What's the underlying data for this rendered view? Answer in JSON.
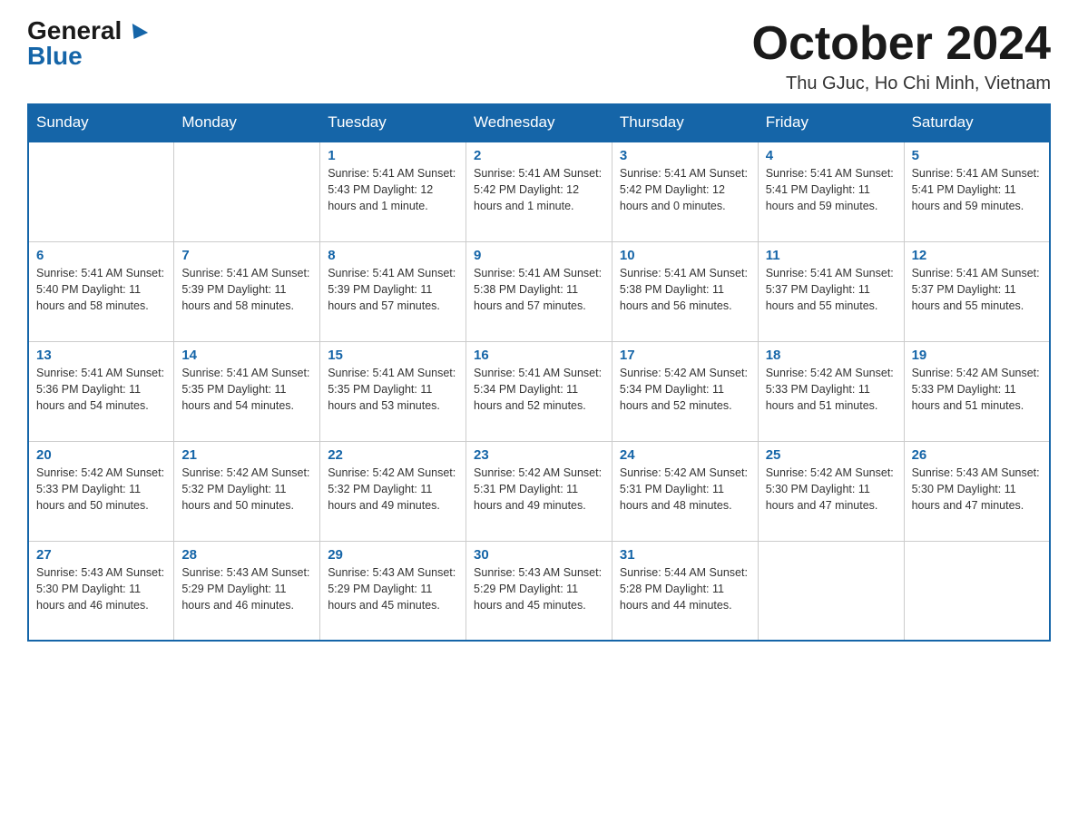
{
  "header": {
    "logo_general": "General",
    "logo_blue": "Blue",
    "month_title": "October 2024",
    "location": "Thu GJuc, Ho Chi Minh, Vietnam"
  },
  "days_of_week": [
    "Sunday",
    "Monday",
    "Tuesday",
    "Wednesday",
    "Thursday",
    "Friday",
    "Saturday"
  ],
  "weeks": [
    [
      {
        "day": "",
        "info": ""
      },
      {
        "day": "",
        "info": ""
      },
      {
        "day": "1",
        "info": "Sunrise: 5:41 AM\nSunset: 5:43 PM\nDaylight: 12 hours\nand 1 minute."
      },
      {
        "day": "2",
        "info": "Sunrise: 5:41 AM\nSunset: 5:42 PM\nDaylight: 12 hours\nand 1 minute."
      },
      {
        "day": "3",
        "info": "Sunrise: 5:41 AM\nSunset: 5:42 PM\nDaylight: 12 hours\nand 0 minutes."
      },
      {
        "day": "4",
        "info": "Sunrise: 5:41 AM\nSunset: 5:41 PM\nDaylight: 11 hours\nand 59 minutes."
      },
      {
        "day": "5",
        "info": "Sunrise: 5:41 AM\nSunset: 5:41 PM\nDaylight: 11 hours\nand 59 minutes."
      }
    ],
    [
      {
        "day": "6",
        "info": "Sunrise: 5:41 AM\nSunset: 5:40 PM\nDaylight: 11 hours\nand 58 minutes."
      },
      {
        "day": "7",
        "info": "Sunrise: 5:41 AM\nSunset: 5:39 PM\nDaylight: 11 hours\nand 58 minutes."
      },
      {
        "day": "8",
        "info": "Sunrise: 5:41 AM\nSunset: 5:39 PM\nDaylight: 11 hours\nand 57 minutes."
      },
      {
        "day": "9",
        "info": "Sunrise: 5:41 AM\nSunset: 5:38 PM\nDaylight: 11 hours\nand 57 minutes."
      },
      {
        "day": "10",
        "info": "Sunrise: 5:41 AM\nSunset: 5:38 PM\nDaylight: 11 hours\nand 56 minutes."
      },
      {
        "day": "11",
        "info": "Sunrise: 5:41 AM\nSunset: 5:37 PM\nDaylight: 11 hours\nand 55 minutes."
      },
      {
        "day": "12",
        "info": "Sunrise: 5:41 AM\nSunset: 5:37 PM\nDaylight: 11 hours\nand 55 minutes."
      }
    ],
    [
      {
        "day": "13",
        "info": "Sunrise: 5:41 AM\nSunset: 5:36 PM\nDaylight: 11 hours\nand 54 minutes."
      },
      {
        "day": "14",
        "info": "Sunrise: 5:41 AM\nSunset: 5:35 PM\nDaylight: 11 hours\nand 54 minutes."
      },
      {
        "day": "15",
        "info": "Sunrise: 5:41 AM\nSunset: 5:35 PM\nDaylight: 11 hours\nand 53 minutes."
      },
      {
        "day": "16",
        "info": "Sunrise: 5:41 AM\nSunset: 5:34 PM\nDaylight: 11 hours\nand 52 minutes."
      },
      {
        "day": "17",
        "info": "Sunrise: 5:42 AM\nSunset: 5:34 PM\nDaylight: 11 hours\nand 52 minutes."
      },
      {
        "day": "18",
        "info": "Sunrise: 5:42 AM\nSunset: 5:33 PM\nDaylight: 11 hours\nand 51 minutes."
      },
      {
        "day": "19",
        "info": "Sunrise: 5:42 AM\nSunset: 5:33 PM\nDaylight: 11 hours\nand 51 minutes."
      }
    ],
    [
      {
        "day": "20",
        "info": "Sunrise: 5:42 AM\nSunset: 5:33 PM\nDaylight: 11 hours\nand 50 minutes."
      },
      {
        "day": "21",
        "info": "Sunrise: 5:42 AM\nSunset: 5:32 PM\nDaylight: 11 hours\nand 50 minutes."
      },
      {
        "day": "22",
        "info": "Sunrise: 5:42 AM\nSunset: 5:32 PM\nDaylight: 11 hours\nand 49 minutes."
      },
      {
        "day": "23",
        "info": "Sunrise: 5:42 AM\nSunset: 5:31 PM\nDaylight: 11 hours\nand 49 minutes."
      },
      {
        "day": "24",
        "info": "Sunrise: 5:42 AM\nSunset: 5:31 PM\nDaylight: 11 hours\nand 48 minutes."
      },
      {
        "day": "25",
        "info": "Sunrise: 5:42 AM\nSunset: 5:30 PM\nDaylight: 11 hours\nand 47 minutes."
      },
      {
        "day": "26",
        "info": "Sunrise: 5:43 AM\nSunset: 5:30 PM\nDaylight: 11 hours\nand 47 minutes."
      }
    ],
    [
      {
        "day": "27",
        "info": "Sunrise: 5:43 AM\nSunset: 5:30 PM\nDaylight: 11 hours\nand 46 minutes."
      },
      {
        "day": "28",
        "info": "Sunrise: 5:43 AM\nSunset: 5:29 PM\nDaylight: 11 hours\nand 46 minutes."
      },
      {
        "day": "29",
        "info": "Sunrise: 5:43 AM\nSunset: 5:29 PM\nDaylight: 11 hours\nand 45 minutes."
      },
      {
        "day": "30",
        "info": "Sunrise: 5:43 AM\nSunset: 5:29 PM\nDaylight: 11 hours\nand 45 minutes."
      },
      {
        "day": "31",
        "info": "Sunrise: 5:44 AM\nSunset: 5:28 PM\nDaylight: 11 hours\nand 44 minutes."
      },
      {
        "day": "",
        "info": ""
      },
      {
        "day": "",
        "info": ""
      }
    ]
  ]
}
